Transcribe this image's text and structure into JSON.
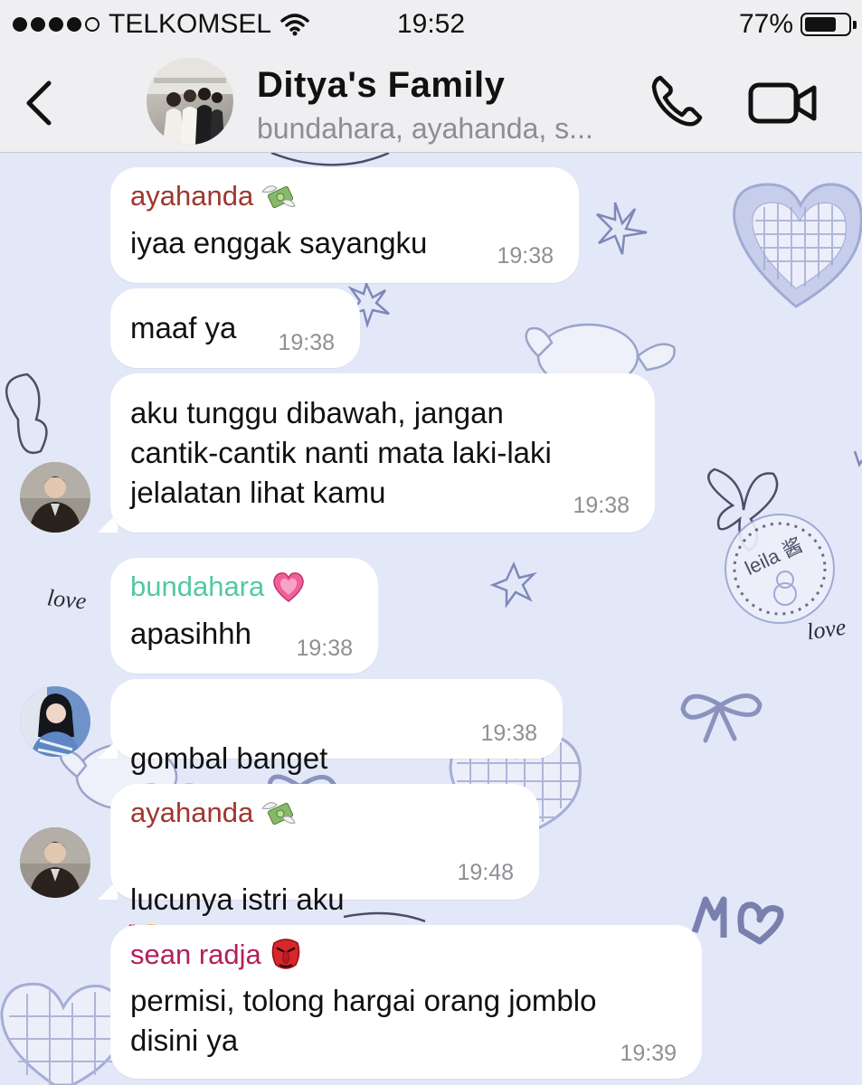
{
  "status_bar": {
    "carrier": "TELKOMSEL",
    "time": "19:52",
    "battery_percent": "77%",
    "battery_level": 0.77,
    "signal_bars_filled": 4,
    "signal_bars_total": 5
  },
  "header": {
    "title": "Ditya's Family",
    "subtitle": "bundahara, ayahanda, s...",
    "icons": [
      "back-chevron-icon",
      "phone-icon",
      "video-camera-icon"
    ]
  },
  "colors": {
    "ayahanda": "#a0362e",
    "bundahara": "#52c9a0",
    "sean_radja": "#b31f5a",
    "bubble": "#ffffff",
    "timestamp": "#8f8f94",
    "wallpaper": "#e3e8f9",
    "header_bg": "#efeff2"
  },
  "messages": [
    {
      "sender": "ayahanda",
      "sender_emoji": "money-with-wings-emoji",
      "text": "iyaa enggak sayangku",
      "time": "19:38"
    },
    {
      "sender": "",
      "text": "maaf ya",
      "time": "19:38"
    },
    {
      "sender": "",
      "text": "aku tunggu dibawah, jangan\ncantik-cantik nanti mata laki-laki\njelalatan lihat kamu",
      "time": "19:38"
    },
    {
      "sender": "bundahara",
      "sender_emoji": "growing-heart-emoji",
      "text": "apasihhh",
      "time": "19:38"
    },
    {
      "sender": "",
      "text": "gombal banget",
      "trailing_emoji": [
        "angry-face-emoji",
        "angry-face-emoji"
      ],
      "time": "19:38"
    },
    {
      "sender": "ayahanda",
      "sender_emoji": "money-with-wings-emoji",
      "text": "lucunya istri aku",
      "trailing_emoji": [
        "smiling-face-with-hearts-emoji"
      ],
      "time": "19:48"
    },
    {
      "sender": "sean radja",
      "sender_emoji": "tengu-mask-emoji",
      "text": "permisi, tolong hargai orang jomblo\ndisini ya",
      "time": "19:39"
    }
  ],
  "wallpaper_text": {
    "love_left": "love",
    "love_right": "love",
    "stamp": "leila 酱"
  }
}
